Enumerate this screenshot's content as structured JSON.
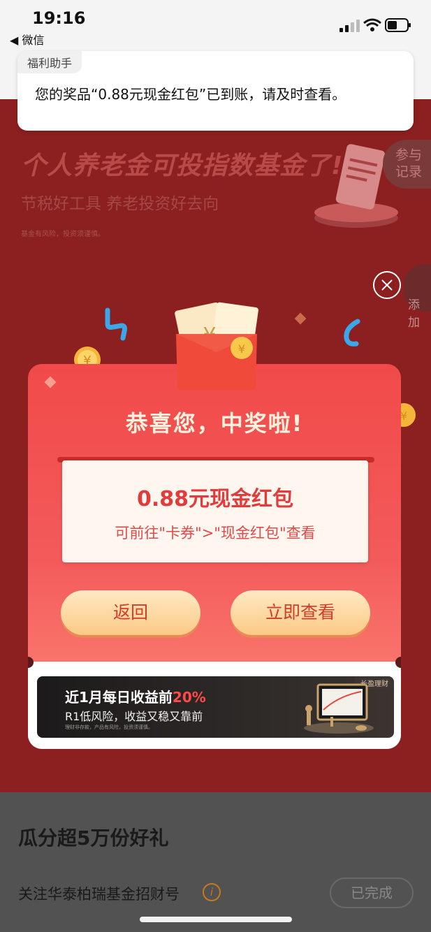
{
  "status_bar": {
    "time": "19:16",
    "back_app": "◀ 微信"
  },
  "notification": {
    "source": "福利助手",
    "message": "您的奖品“0.88元现金红包”已到账，请及时查看。"
  },
  "background_page": {
    "banner_title": "个人养老金可投指数基金了!",
    "banner_subtitle": "节税好工具 养老投资好去向",
    "banner_note": "基金有风险，投资须谨慎。",
    "records_button": "参与\n记录",
    "add_label": "添加",
    "section_title": "瓜分超5万份好礼",
    "task_label": "关注华泰柏瑞基金招财号",
    "task_status": "已完成"
  },
  "modal": {
    "title": "恭喜您，中奖啦!",
    "prize_name": "0.88元现金红包",
    "prize_hint": "可前往\"卡券\">\"现金红包\"查看",
    "back_button": "返回",
    "view_button": "立即查看",
    "ad": {
      "line1_prefix": "近1月每日收益前",
      "line1_highlight": "20%",
      "line2": "R1低风险，收益又稳又靠前",
      "line3": "理财非存款，产品有风险，投资须谨慎。",
      "tag": "长盈理财"
    }
  },
  "colors": {
    "modal_red": "#f24a4a",
    "button_gold": "#fbc986",
    "prize_text": "#e23b3b",
    "page_red": "#8c1f1f"
  }
}
